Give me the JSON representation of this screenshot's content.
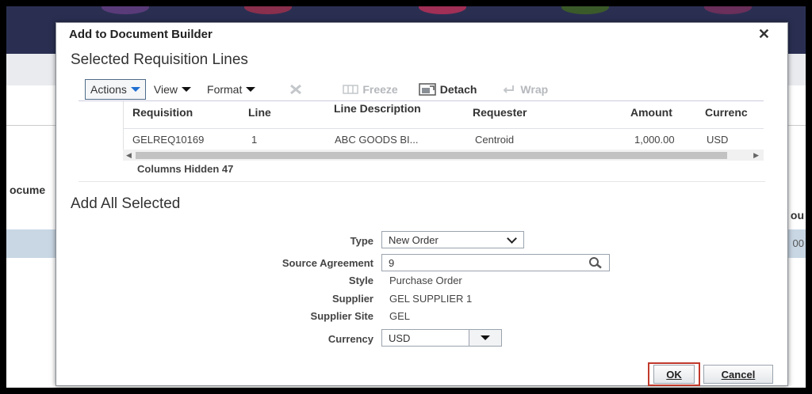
{
  "background": {
    "left_text": "ocume",
    "right_text": "ou",
    "right_row_text": "00"
  },
  "dialog": {
    "title": "Add to Document Builder",
    "close_glyph": "✕"
  },
  "selected_lines": {
    "heading": "Selected Requisition Lines",
    "toolbar": {
      "actions": "Actions",
      "view": "View",
      "format": "Format",
      "freeze": "Freeze",
      "detach": "Detach",
      "wrap": "Wrap"
    },
    "columns": [
      "Requisition",
      "Line",
      "Line Description",
      "Requester",
      "Amount",
      "Currenc"
    ],
    "rows": [
      [
        "GELREQ10169",
        "1",
        "ABC GOODS BI...",
        "Centroid",
        "1,000.00",
        "USD"
      ]
    ],
    "columns_hidden_label": "Columns Hidden",
    "columns_hidden_count": "47"
  },
  "add_all": {
    "heading": "Add All Selected",
    "type_label": "Type",
    "type_value": "New Order",
    "source_label": "Source Agreement",
    "source_value": "9",
    "style_label": "Style",
    "style_value": "Purchase Order",
    "supplier_label": "Supplier",
    "supplier_value": "GEL SUPPLIER 1",
    "site_label": "Supplier Site",
    "site_value": "GEL",
    "currency_label": "Currency",
    "currency_value": "USD"
  },
  "buttons": {
    "ok": "OK",
    "cancel": "Cancel"
  },
  "colors": {
    "accent_blue": "#1f6fd1",
    "highlight_red": "#c0392b",
    "header_navy": "#2a2f52"
  }
}
